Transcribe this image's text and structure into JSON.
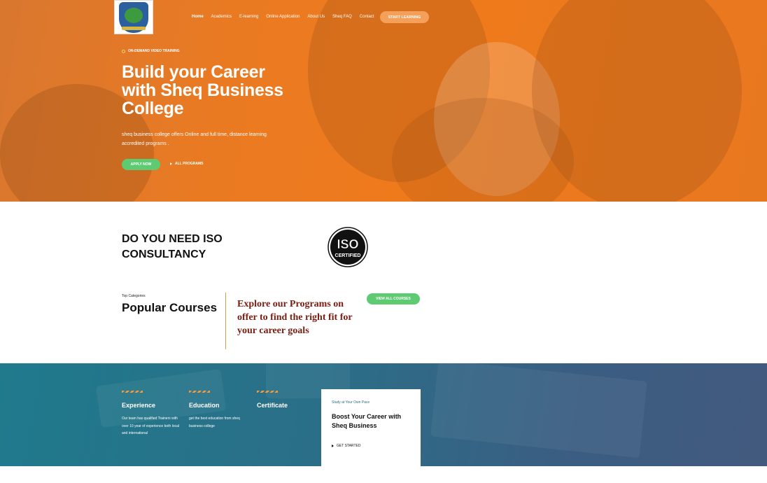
{
  "nav": {
    "items": [
      "Home",
      "Academics",
      "E-learning",
      "Online Application",
      "About Us",
      "Sheq FAQ",
      "Contact"
    ],
    "cta": "START LEARNING"
  },
  "hero": {
    "eyebrow": "ON-DEMAND VIDEO TRAINING",
    "title": "Build your Career with Sheq Business College",
    "description": "sheq business college offers Online and full time, distance learning  accredited programs .",
    "apply": "APPLY NOW",
    "all_programs": "ALL PROGRAMS"
  },
  "iso": {
    "title": "DO YOU NEED ISO CONSULTANCY",
    "badge_top": "ISO",
    "badge_bottom": "CERTIFIED"
  },
  "courses": {
    "kicker": "Top Categories",
    "title": "Popular Courses",
    "explore": "Explore our Programs on offer to find the right fit for your career goals",
    "view_all": "VIEW ALL COURSES"
  },
  "features": [
    {
      "title": "Experience",
      "text": "Our team has qualified Trainers with over 10 year of experience both local and international"
    },
    {
      "title": "Education",
      "text": "get the best education from sheq  business college"
    },
    {
      "title": "Certificate",
      "text": ""
    }
  ],
  "card": {
    "kicker": "Study at Your Own Pace",
    "title": "Boost Your Career with Sheq Business",
    "link": "GET STARTED"
  },
  "colors": {
    "hero": "#ef7a1c",
    "green_button": "#5ecb73",
    "teal": "#2a6f88",
    "explore_text": "#7a1d12"
  }
}
